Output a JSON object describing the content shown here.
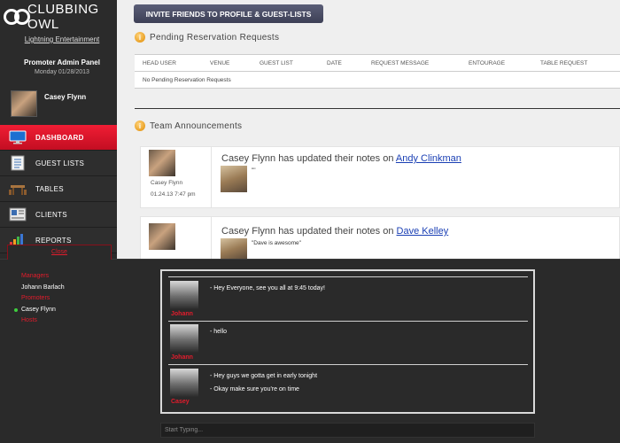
{
  "brand": {
    "name": "CLUBBING OWL"
  },
  "sidebar": {
    "org_link": "Lightning Entertainment",
    "panel_title": "Promoter Admin Panel",
    "date": "Monday 01/28/2013",
    "user_name": "Casey Flynn",
    "nav": [
      {
        "label": "DASHBOARD",
        "icon": "monitor-icon",
        "active": true
      },
      {
        "label": "GUEST LISTS",
        "icon": "list-icon",
        "active": false
      },
      {
        "label": "TABLES",
        "icon": "table-icon",
        "active": false
      },
      {
        "label": "CLIENTS",
        "icon": "clients-icon",
        "active": false
      },
      {
        "label": "REPORTS",
        "icon": "bar-chart-icon",
        "active": false
      }
    ]
  },
  "main": {
    "invite_button": "INVITE FRIENDS TO PROFILE & GUEST-LISTS",
    "pending_title": "Pending Reservation Requests",
    "table": {
      "columns": [
        "HEAD USER",
        "VENUE",
        "GUEST LIST",
        "DATE",
        "REQUEST MESSAGE",
        "ENTOURAGE",
        "TABLE REQUEST"
      ],
      "empty_message": "No Pending Reservation Requests"
    },
    "announcements_title": "Team Announcements",
    "announcements": [
      {
        "author": "Casey Flynn",
        "timestamp": "01.24.13 7:47 pm",
        "text": "Casey Flynn has updated their notes on",
        "link": "Andy Clinkman",
        "note": "\"\""
      },
      {
        "author": "Casey Flynn",
        "timestamp": "",
        "text": "Casey Flynn has updated their notes on",
        "link": "Dave Kelley",
        "note": "\"Dave is awesome\""
      }
    ]
  },
  "chat": {
    "close_label": "Close",
    "roster": {
      "managers_label": "Managers",
      "managers": [
        "Johann Barlach"
      ],
      "promoters_label": "Promoters",
      "promoters": [
        "Casey Flynn"
      ],
      "hosts_label": "Hosts"
    },
    "messages": [
      {
        "name": "Johann",
        "lines": [
          "- Hey Everyone, see you all at 9:45 today!"
        ]
      },
      {
        "name": "Johann",
        "lines": [
          "- hello"
        ]
      },
      {
        "name": "Casey",
        "lines": [
          "- Hey guys we gotta get in early tonight",
          "- Okay make sure you're on time"
        ]
      }
    ],
    "input_placeholder": "Start Typing..."
  },
  "colors": {
    "accent_red": "#e21c2c",
    "sidebar_bg": "#2b2b2b",
    "link_blue": "#1a3fb4",
    "online_green": "#3fcf3f"
  }
}
